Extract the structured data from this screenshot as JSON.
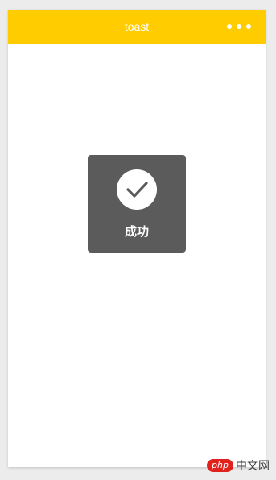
{
  "navbar": {
    "title": "toast",
    "menu_icon": "more-dots-icon",
    "bg_color": "#ffcc00"
  },
  "toast": {
    "icon": "checkmark-icon",
    "message": "成功",
    "bg_color": "#5b5b5b"
  },
  "watermark": {
    "logo_text": "php",
    "text": "中文网"
  }
}
